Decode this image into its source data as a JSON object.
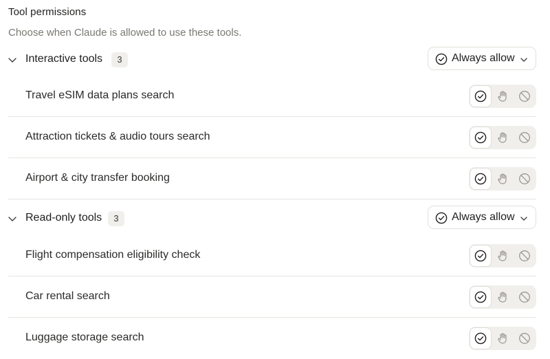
{
  "title": "Tool permissions",
  "subtitle": "Choose when Claude is allowed to use these tools.",
  "groups": [
    {
      "label": "Interactive tools",
      "count": "3",
      "setting": "Always allow",
      "tools": [
        {
          "label": "Travel eSIM data plans search",
          "permission": "always-allow"
        },
        {
          "label": "Attraction tickets & audio tours search",
          "permission": "always-allow"
        },
        {
          "label": "Airport & city transfer booking",
          "permission": "always-allow"
        }
      ]
    },
    {
      "label": "Read-only tools",
      "count": "3",
      "setting": "Always allow",
      "tools": [
        {
          "label": "Flight compensation eligibility check",
          "permission": "always-allow"
        },
        {
          "label": "Car rental search",
          "permission": "always-allow"
        },
        {
          "label": "Luggage storage search",
          "permission": "always-allow"
        }
      ]
    }
  ],
  "icons": {
    "check": "check-circle-icon",
    "ask": "hand-icon",
    "block": "block-icon",
    "chevron": "chevron-down-icon"
  },
  "colors": {
    "active_icon": "#1f1e1d",
    "inactive_icon": "#9b9893",
    "segment_bg": "#f0efec"
  }
}
